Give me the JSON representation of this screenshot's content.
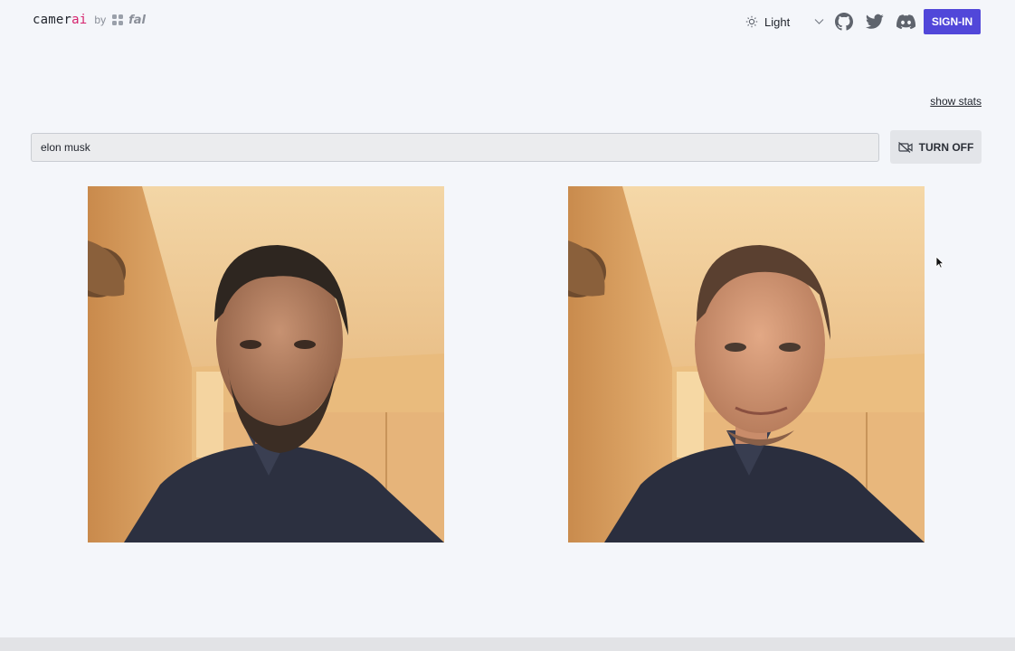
{
  "header": {
    "brand": {
      "name_prefix": "camer",
      "name_accent": "ai",
      "by": "by",
      "partner": "fal"
    },
    "theme": {
      "label": "Light",
      "icon": "sun-icon"
    },
    "icons": [
      "github-icon",
      "twitter-icon",
      "discord-icon"
    ],
    "signin_label": "SIGN-IN",
    "accent_color": "#5147d9"
  },
  "toolbar": {
    "show_stats": "show stats"
  },
  "prompt": {
    "value": "elon musk",
    "placeholder": ""
  },
  "camera_button": {
    "label": "TURN OFF",
    "icon": "video-off-icon"
  },
  "feeds": [
    {
      "name": "webcam-input"
    },
    {
      "name": "generated-output"
    }
  ]
}
